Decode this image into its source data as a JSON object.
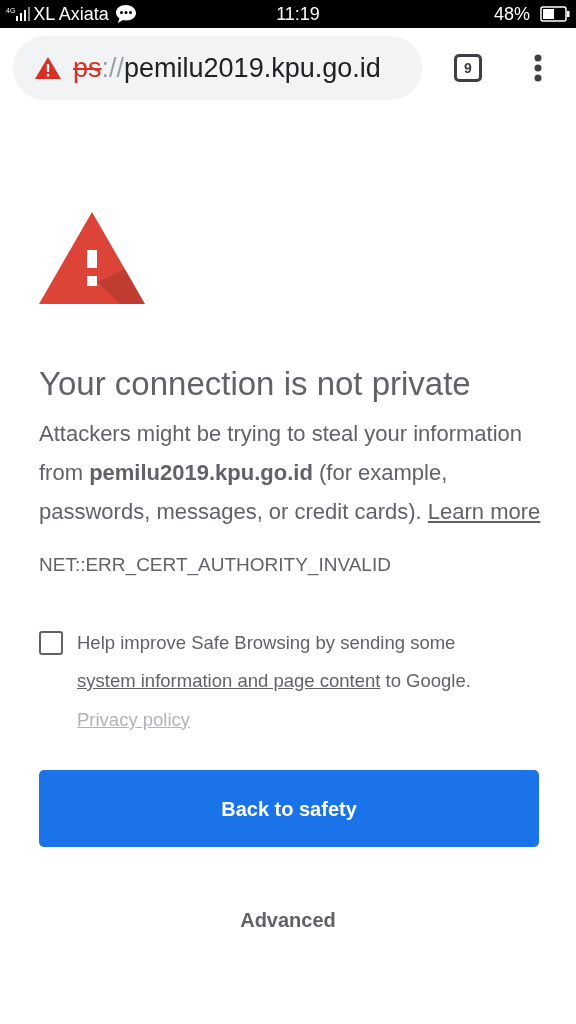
{
  "status_bar": {
    "network": "4G",
    "carrier": "XL Axiata",
    "time": "11:19",
    "battery": "48%"
  },
  "address_bar": {
    "scheme": "ps",
    "separator": "://",
    "host": "pemilu2019.kpu.go.id",
    "tab_count": "9"
  },
  "heading": "Your connection is not private",
  "message": "Attackers might be trying to steal your information from **pemilu2019.kpu.go.id** (for example, passwords, messages, or credit cards).",
  "learn_more": "Learn more",
  "error_code": "NET::ERR_CERT_AUTHORITY_INVALID",
  "opt_in": {
    "checked": false,
    "text_before": "Help improve Safe Browsing by sending some",
    "link": "system information and page content",
    "text_after": "to Google.",
    "privacy_link": "Privacy policy"
  },
  "primary_button": "Back to safety",
  "advanced_button": "Advanced"
}
